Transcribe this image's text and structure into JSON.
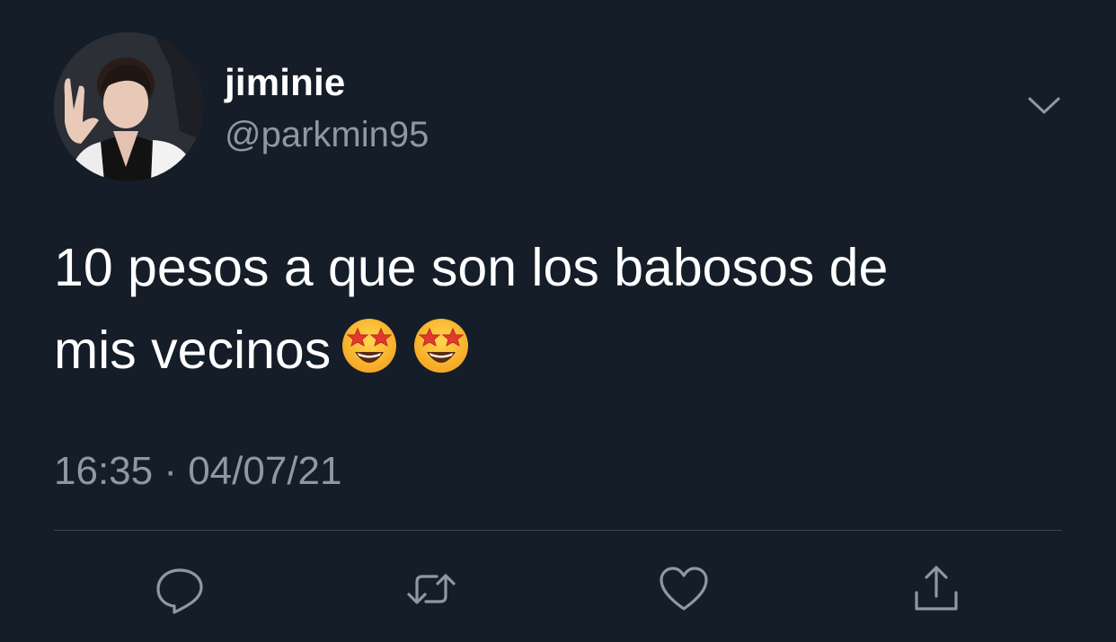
{
  "colors": {
    "background": "#151d28",
    "text_primary": "#ffffff",
    "text_secondary": "#8d98a5",
    "divider": "#38444d",
    "icon": "#8d98a5"
  },
  "author": {
    "display_name": "jiminie",
    "handle": "@parkmin95",
    "avatar_icon": "profile-photo"
  },
  "menu": {
    "icon": "chevron-down-icon"
  },
  "tweet": {
    "text_line_1": "10 pesos a que son los babosos de",
    "text_line_2": "mis vecinos",
    "emojis": [
      "star-struck",
      "star-struck"
    ],
    "timestamp": "16:35 · 04/07/21"
  },
  "actions": [
    {
      "icon": "reply-icon"
    },
    {
      "icon": "retweet-icon"
    },
    {
      "icon": "like-icon"
    },
    {
      "icon": "share-icon"
    }
  ]
}
